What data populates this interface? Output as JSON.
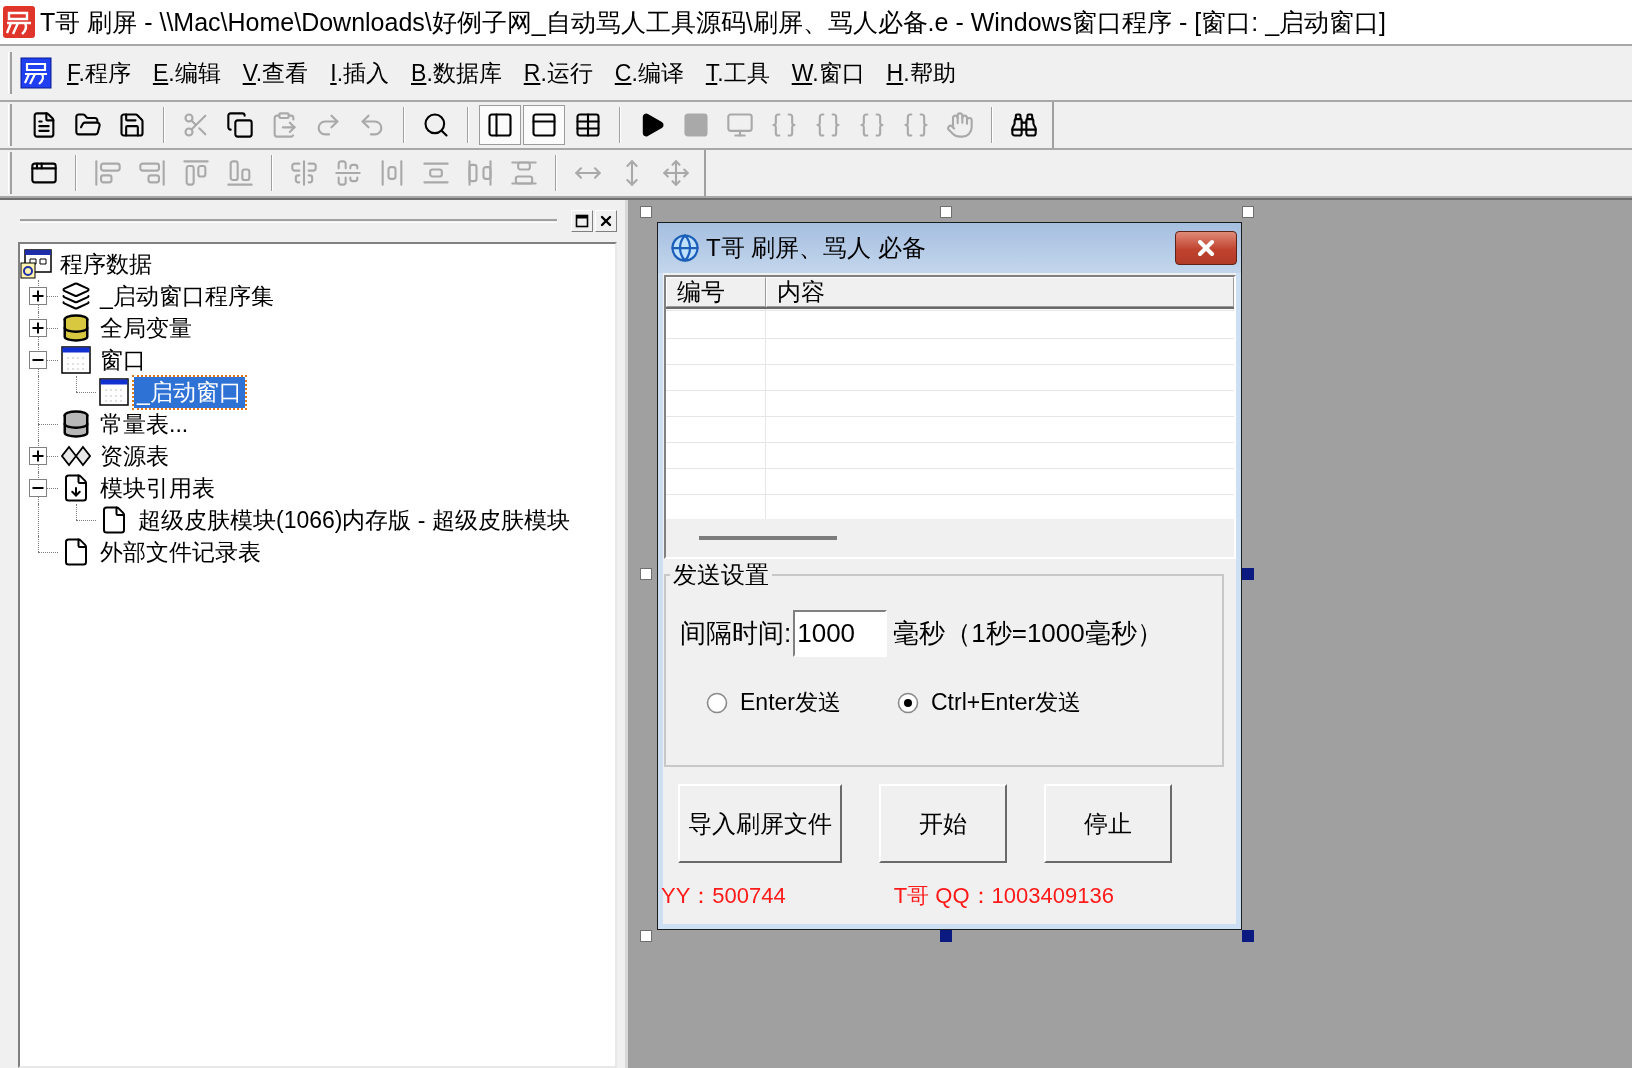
{
  "window": {
    "title": "T哥 刷屏 - \\\\Mac\\Home\\Downloads\\好例子网_自动骂人工具源码\\刷屏、骂人必备.e - Windows窗口程序 - [窗口: _启动窗口]"
  },
  "menu": [
    "F.程序",
    "E.编辑",
    "V.查看",
    "I.插入",
    "B.数据库",
    "R.运行",
    "C.编译",
    "T.工具",
    "W.窗口",
    "H.帮助"
  ],
  "toolbars": [
    {
      "groups": [
        {
          "buttons": [
            {
              "kind": "new",
              "disabled": false,
              "pressed": false
            },
            {
              "kind": "open",
              "disabled": false,
              "pressed": false
            },
            {
              "kind": "save",
              "disabled": false,
              "pressed": false
            }
          ]
        },
        {
          "buttons": [
            {
              "kind": "cut",
              "disabled": true,
              "pressed": false
            },
            {
              "kind": "copy",
              "disabled": false,
              "pressed": false
            },
            {
              "kind": "paste",
              "disabled": true,
              "pressed": false
            },
            {
              "kind": "redo",
              "disabled": true,
              "pressed": false
            },
            {
              "kind": "undo",
              "disabled": true,
              "pressed": false
            }
          ]
        },
        {
          "buttons": [
            {
              "kind": "find",
              "disabled": false,
              "pressed": false
            }
          ]
        },
        {
          "buttons": [
            {
              "kind": "panes",
              "disabled": false,
              "pressed": true
            },
            {
              "kind": "split",
              "disabled": false,
              "pressed": true
            },
            {
              "kind": "grid",
              "disabled": false,
              "pressed": false
            }
          ]
        },
        {
          "buttons": [
            {
              "kind": "run",
              "disabled": false,
              "pressed": false
            },
            {
              "kind": "stop",
              "disabled": true,
              "pressed": false
            },
            {
              "kind": "build",
              "disabled": true,
              "pressed": false
            },
            {
              "kind": "stepinto",
              "disabled": true,
              "pressed": false
            },
            {
              "kind": "stepover",
              "disabled": true,
              "pressed": false
            },
            {
              "kind": "stepout",
              "disabled": true,
              "pressed": false
            },
            {
              "kind": "tocursor",
              "disabled": true,
              "pressed": false
            },
            {
              "kind": "pause",
              "disabled": true,
              "pressed": false
            }
          ]
        },
        {
          "buttons": [
            {
              "kind": "help",
              "disabled": false,
              "pressed": false
            }
          ]
        }
      ]
    },
    {
      "groups": [
        {
          "buttons": [
            {
              "kind": "form",
              "disabled": false,
              "pressed": false
            }
          ]
        },
        {
          "buttons": [
            {
              "kind": "alignleft",
              "disabled": true,
              "pressed": false
            },
            {
              "kind": "alignright",
              "disabled": true,
              "pressed": false
            },
            {
              "kind": "aligntop",
              "disabled": true,
              "pressed": false
            },
            {
              "kind": "alignbottom",
              "disabled": true,
              "pressed": false
            }
          ]
        },
        {
          "buttons": [
            {
              "kind": "centerh",
              "disabled": true,
              "pressed": false
            },
            {
              "kind": "centerv",
              "disabled": true,
              "pressed": false
            },
            {
              "kind": "spreadh",
              "disabled": true,
              "pressed": false
            },
            {
              "kind": "spreadv",
              "disabled": true,
              "pressed": false
            },
            {
              "kind": "spaceh",
              "disabled": true,
              "pressed": false
            },
            {
              "kind": "spacev",
              "disabled": true,
              "pressed": false
            }
          ]
        },
        {
          "buttons": [
            {
              "kind": "samewidth",
              "disabled": true,
              "pressed": false
            },
            {
              "kind": "sameheight",
              "disabled": true,
              "pressed": false
            },
            {
              "kind": "samesize",
              "disabled": true,
              "pressed": false
            }
          ]
        }
      ]
    }
  ],
  "tree": {
    "label": "程序数据",
    "kind": "program",
    "selected": false,
    "children": [
      {
        "label": "_启动窗口程序集",
        "kind": "assembly",
        "expandable": true,
        "expanded": false,
        "selected": false
      },
      {
        "label": "全局变量",
        "kind": "variables",
        "expandable": true,
        "expanded": false,
        "selected": false
      },
      {
        "label": "窗口",
        "kind": "window",
        "expandable": true,
        "expanded": true,
        "selected": false,
        "children": [
          {
            "label": "_启动窗口",
            "kind": "window",
            "expandable": false,
            "selected": true
          }
        ]
      },
      {
        "label": "常量表...",
        "kind": "constants",
        "expandable": false,
        "selected": false
      },
      {
        "label": "资源表",
        "kind": "resources",
        "expandable": true,
        "expanded": false,
        "selected": false
      },
      {
        "label": "模块引用表",
        "kind": "modules",
        "expandable": true,
        "expanded": true,
        "selected": false,
        "children": [
          {
            "label": "超级皮肤模块(1066)内存版 - 超级皮肤模块",
            "kind": "document",
            "expandable": false,
            "selected": false
          }
        ]
      },
      {
        "label": "外部文件记录表",
        "kind": "document",
        "expandable": false,
        "selected": false
      }
    ]
  },
  "designer": {
    "handles": [
      {
        "filled": false
      },
      {
        "filled": false
      },
      {
        "filled": false
      },
      {
        "filled": false
      },
      {
        "filled": true
      },
      {
        "filled": false
      },
      {
        "filled": true
      },
      {
        "filled": true
      }
    ],
    "form": {
      "title": "T哥 刷屏、骂人 必备",
      "list": {
        "columns": [
          "编号",
          "内容"
        ]
      },
      "group": {
        "title": "发送设置",
        "interval": {
          "label": "间隔时间:",
          "value": "1000",
          "unit": "毫秒（1秒=1000毫秒）"
        },
        "options": [
          {
            "label": "Enter发送",
            "selected": false
          },
          {
            "label": "Ctrl+Enter发送",
            "selected": true
          }
        ]
      },
      "buttons": [
        "导入刷屏文件",
        "开始",
        "停止"
      ],
      "footer": [
        "YY：500744",
        "T哥 QQ：1003409136"
      ]
    }
  }
}
